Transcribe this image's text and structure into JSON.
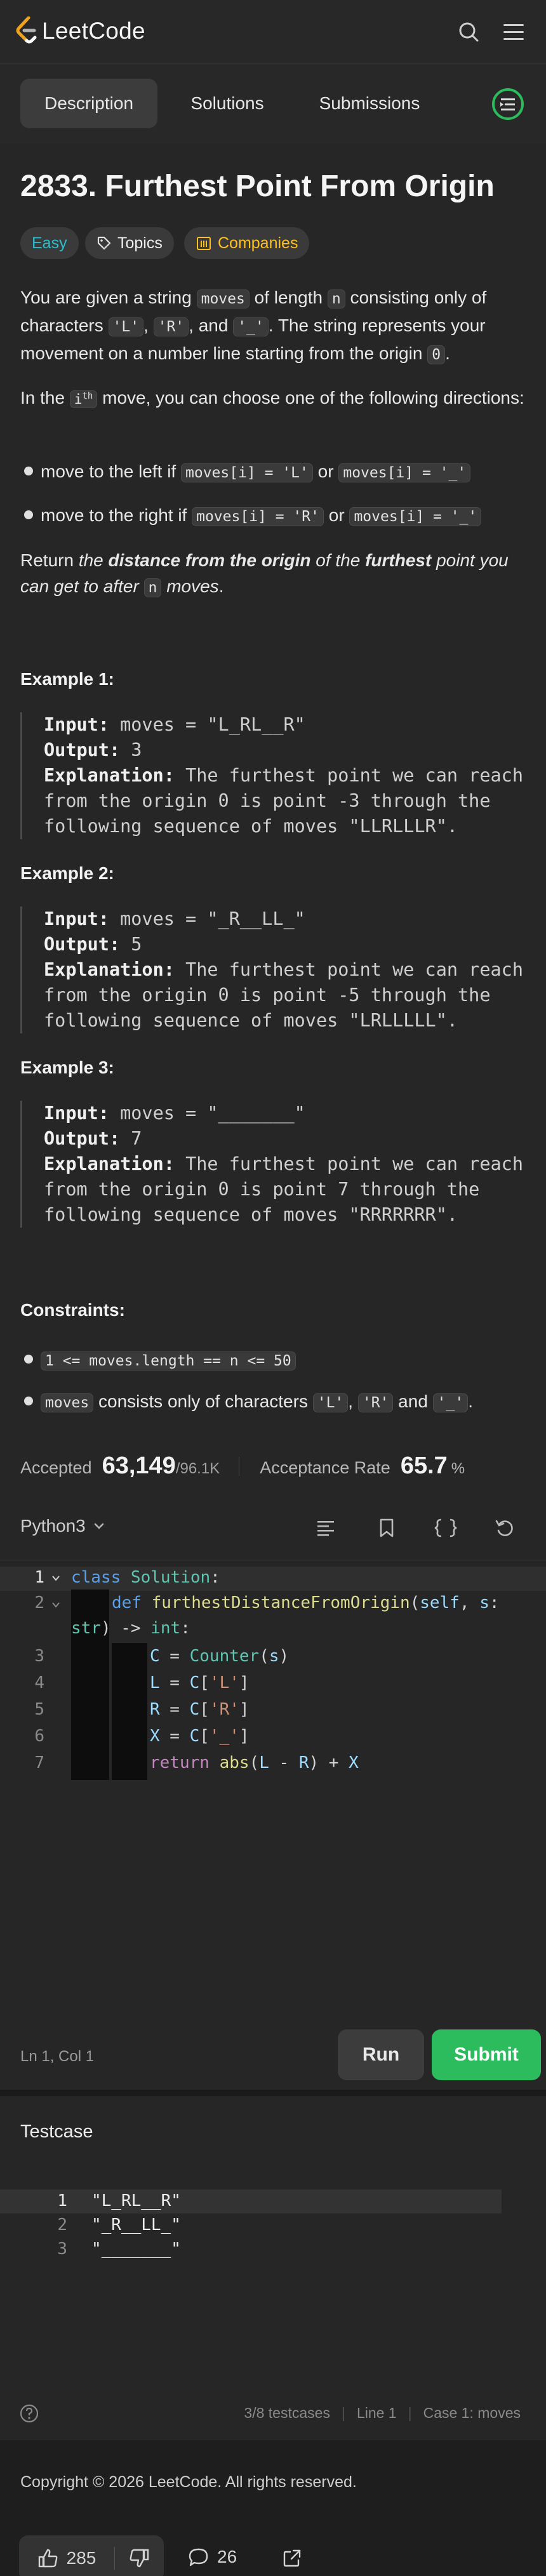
{
  "app": {
    "name": "LeetCode"
  },
  "colors": {
    "bg": "#1a1a1a",
    "panel": "#262626",
    "accent_green": "#2cbb5d",
    "easy": "#2cbccb",
    "companies": "#ffc01e"
  },
  "tabs": [
    {
      "label": "Description"
    },
    {
      "label": "Solutions"
    },
    {
      "label": "Submissions"
    }
  ],
  "problem": {
    "title": "2833. Furthest Point From Origin",
    "difficulty": "Easy",
    "topics_label": "Topics",
    "companies_label": "Companies",
    "p1": {
      "a": "You are given a string ",
      "b": "moves",
      "c": " of length ",
      "d": "n",
      "e": " consisting only of characters ",
      "f": "'L'",
      "g": ", ",
      "h": "'R'",
      "i": ", and ",
      "j": "'_'",
      "k": ". The string represents your movement on a number line starting from the origin ",
      "l": "0",
      "m": "."
    },
    "p2": {
      "a": "In the ",
      "b": "i",
      "c": "th",
      "d": " move, you can choose one of the following directions:"
    },
    "bullets": [
      {
        "a": "move to the left if ",
        "c1": "moves[i] = 'L'",
        "or": " or ",
        "c2": "moves[i] = '_'"
      },
      {
        "a": "move to the right if ",
        "c1": "moves[i] = 'R'",
        "or": " or ",
        "c2": "moves[i] = '_'"
      }
    ],
    "p3": {
      "a": "Return ",
      "b": "the ",
      "c": "distance from the origin",
      "d": " of the ",
      "e": "furthest",
      "f": " point you can get to after ",
      "g": "n",
      "h": " moves",
      "i": "."
    },
    "examples": [
      {
        "heading": "Example 1:",
        "input_label": "Input:",
        "input": " moves = \"L_RL__R\"",
        "output_label": "Output:",
        "output": " 3",
        "expl_label": "Explanation:",
        "expl1": " The furthest point we can reach",
        "expl2": "from the origin 0 is point -3 through the",
        "expl3": "following sequence of moves \"LLRLLLR\"."
      },
      {
        "heading": "Example 2:",
        "input_label": "Input:",
        "input": " moves = \"_R__LL_\"",
        "output_label": "Output:",
        "output": " 5",
        "expl_label": "Explanation:",
        "expl1": " The furthest point we can reach",
        "expl2": "from the origin 0 is point -5 through the",
        "expl3": "following sequence of moves \"LRLLLLL\"."
      },
      {
        "heading": "Example 3:",
        "input_label": "Input:",
        "input": " moves = \"_______\"",
        "output_label": "Output:",
        "output": " 7",
        "expl_label": "Explanation:",
        "expl1": " The furthest point we can reach",
        "expl2": "from the origin 0 is point 7 through the",
        "expl3": "following sequence of moves \"RRRRRRR\"."
      }
    ],
    "constraints_heading": "Constraints:",
    "constraints": {
      "c1": "1 <= moves.length == n <= 50",
      "c2a": "moves",
      "c2b": " consists only of characters ",
      "c2c": "'L'",
      "c2d": ", ",
      "c2e": "'R'",
      "c2f": " and ",
      "c2g": "'_'",
      "c2h": "."
    },
    "stats": {
      "accepted_label": "Accepted",
      "accepted": "63,149",
      "total": "/96.1K",
      "rate_label": "Acceptance Rate",
      "rate": "65.7",
      "rate_unit": "%"
    }
  },
  "editor": {
    "language": "Python3",
    "status": "Ln 1, Col 1",
    "run_label": "Run",
    "submit_label": "Submit",
    "lines": [
      "1",
      "2",
      "",
      "3",
      "4",
      "5",
      "6",
      "7"
    ],
    "code": {
      "l1a": "class",
      "l1b": " Solution",
      ":": ":",
      "l2a": "def",
      "l2b": " furthestDistanceFromOrigin",
      "l2c": "(",
      "l2d": "self",
      ",": ", ",
      "l2e": "s",
      ":2": ":",
      "l2f": "str",
      ")": ")",
      "l2g": " -> ",
      "l2h": "int",
      ":3": ":",
      "l3": [
        "C",
        " = ",
        "Counter",
        "(",
        "s",
        ")"
      ],
      "l4": [
        "L",
        " = ",
        "C",
        "[",
        "'L'",
        "]"
      ],
      "l5": [
        "R",
        " = ",
        "C",
        "[",
        "'R'",
        "]"
      ],
      "l6": [
        "X",
        " = ",
        "C",
        "[",
        "'_'",
        "]"
      ],
      "l7": [
        "return",
        " abs",
        "(",
        "L",
        " - ",
        "R",
        ")",
        " + ",
        "X"
      ]
    }
  },
  "testcase": {
    "title": "Testcase",
    "lines": [
      "1",
      "2",
      "3"
    ],
    "values": [
      "\"L_RL__R\"",
      "\"_R__LL_\"",
      "\"_______\""
    ],
    "status": {
      "count": "3/8 testcases",
      "line": "Line 1",
      "case": "Case 1: moves"
    }
  },
  "footer": {
    "copyright": "Copyright © 2026 LeetCode. All rights reserved.",
    "likes": "285",
    "comments": "26"
  }
}
